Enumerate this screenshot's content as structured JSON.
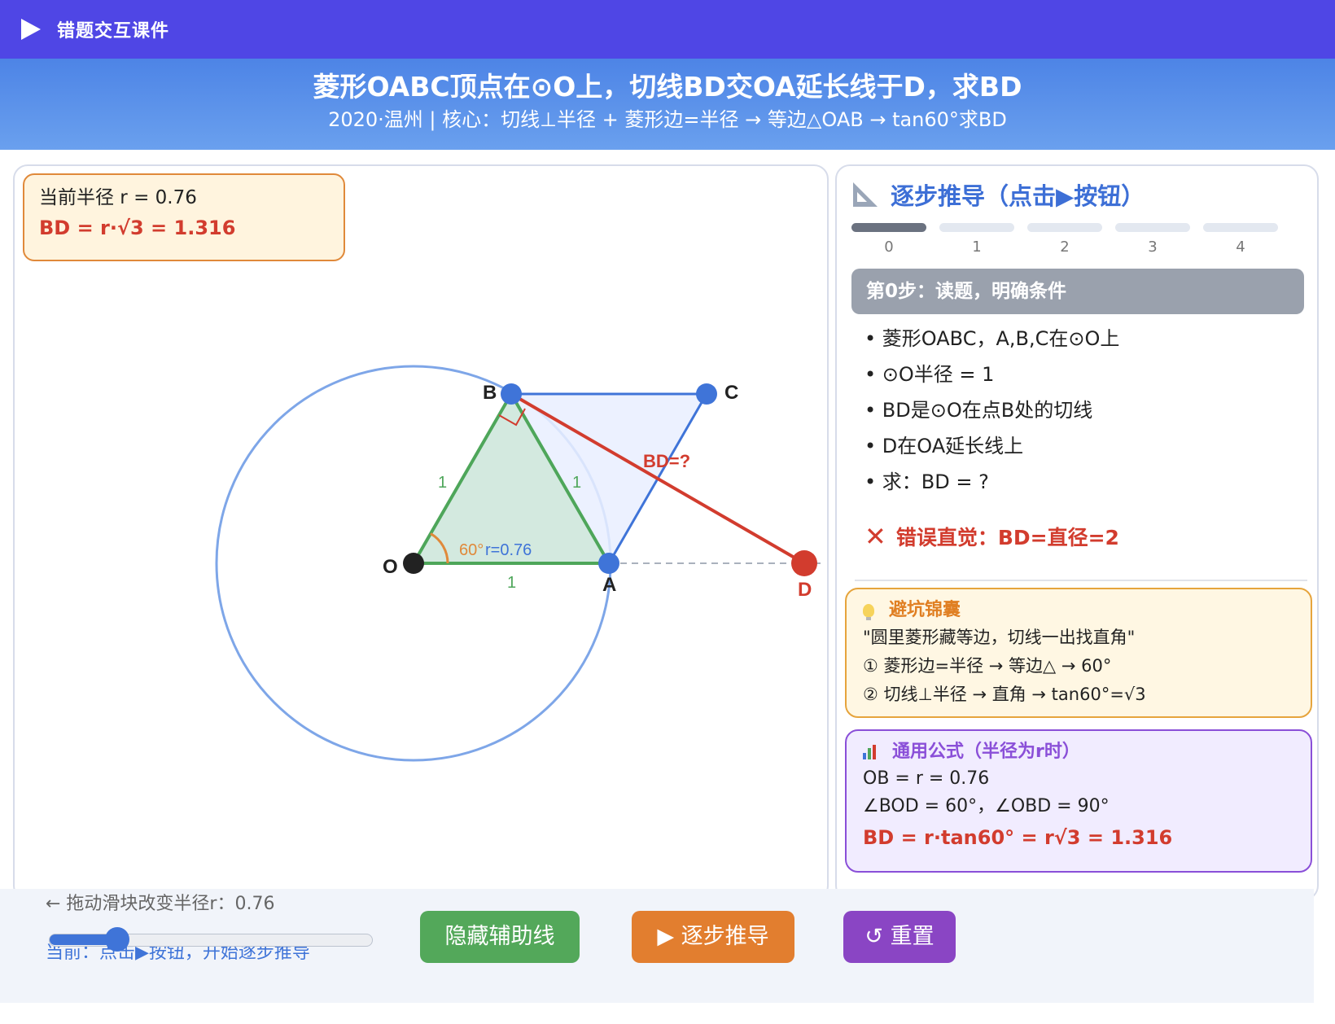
{
  "app": {
    "title": "错题交互课件"
  },
  "header": {
    "title": "菱形OABC顶点在⊙O上，切线BD交OA延长线于D，求BD",
    "subtitle": "2020·温州 | 核心：切线⊥半径 + 菱形边=半径 → 等边△OAB → tan60°求BD"
  },
  "figure": {
    "radius_text": "当前半径 r = 0.76",
    "bd_text": "BD = r·√3 = 1.316",
    "points": {
      "O": "O",
      "A": "A",
      "B": "B",
      "C": "C",
      "D": "D"
    },
    "labels": {
      "side_ob": "1",
      "side_ab": "1",
      "side_oa": "1",
      "angle": "60°",
      "radius": "r=0.76",
      "bd_unknown": "BD=?"
    },
    "colors": {
      "circle": "#7ea6e8",
      "rhombus": "#3f74d8",
      "triangle": "#4ea65a",
      "tangent": "#d23c2e",
      "angle": "#e0893a"
    }
  },
  "panel": {
    "title": "逐步推导（点击▶按钮）",
    "steps": [
      "0",
      "1",
      "2",
      "3",
      "4"
    ],
    "active_step": 0,
    "step_title": "第0步：读题，明确条件",
    "conditions": [
      "• 菱形OABC，A,B,C在⊙O上",
      "• ⊙O半径 = 1",
      "• BD是⊙O在点B处的切线",
      "• D在OA延长线上",
      "• 求：BD = ?"
    ],
    "wrong_intuition": "错误直觉：BD=直径=2",
    "tip": {
      "title": "避坑锦囊",
      "lines": [
        "\"圆里菱形藏等边，切线一出找直角\"",
        "① 菱形边=半径 → 等边△ → 60°",
        "② 切线⊥半径 → 直角 → tan60°=√3"
      ]
    },
    "formula": {
      "title": "通用公式（半径为r时）",
      "lines": [
        "OB = r = 0.76",
        "∠BOD = 60°，∠OBD = 90°"
      ],
      "result": "BD = r·tan60° = r√3 = 1.316"
    }
  },
  "controls": {
    "slider_label": "← 拖动滑块改变半径r：0.76",
    "slider_value": 0.76,
    "status": "当前：点击▶按钮，开始逐步推导",
    "buttons": {
      "toggle_aux": "隐藏辅助线",
      "step": "▶ 逐步推导",
      "reset": "↺ 重置"
    }
  }
}
